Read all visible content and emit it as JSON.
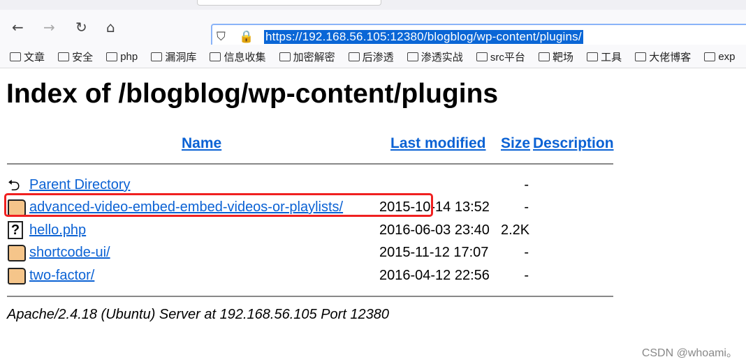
{
  "browser": {
    "url": "https://192.168.56.105:12380/blogblog/wp-content/plugins/",
    "nav": {
      "back": "←",
      "forward": "→",
      "reload": "↻",
      "home": "⌂"
    },
    "bookmarks": [
      "文章",
      "安全",
      "php",
      "漏洞库",
      "信息收集",
      "加密解密",
      "后渗透",
      "渗透实战",
      "src平台",
      "靶场",
      "工具",
      "大佬博客",
      "exp"
    ]
  },
  "page": {
    "title": "Index of /blogblog/wp-content/plugins",
    "columns": {
      "name": "Name",
      "modified": "Last modified",
      "size": "Size",
      "description": "Description"
    },
    "rows": [
      {
        "icon": "back-icon",
        "name": "Parent Directory",
        "modified": "",
        "size": "-"
      },
      {
        "icon": "folder-icon",
        "name": "advanced-video-embed-embed-videos-or-playlists/",
        "modified": "2015-10-14 13:52",
        "size": "-",
        "highlighted": true
      },
      {
        "icon": "unknown-file-icon",
        "name": "hello.php",
        "modified": "2016-06-03 23:40",
        "size": "2.2K"
      },
      {
        "icon": "folder-icon",
        "name": "shortcode-ui/",
        "modified": "2015-11-12 17:07",
        "size": "-"
      },
      {
        "icon": "folder-icon",
        "name": "two-factor/",
        "modified": "2016-04-12 22:56",
        "size": "-"
      }
    ],
    "address": "Apache/2.4.18 (Ubuntu) Server at 192.168.56.105 Port 12380"
  },
  "watermark": "CSDN @whoami。",
  "colors": {
    "link": "#0b62d4",
    "highlight": "#f02020",
    "url_selection": "#0a66d6"
  }
}
